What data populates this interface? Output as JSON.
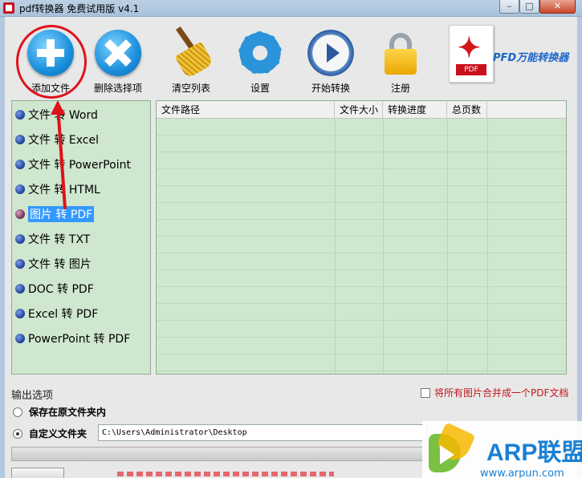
{
  "window": {
    "title": "pdf转换器 免费试用版 v4.1",
    "min_symbol": "–",
    "max_symbol": "□",
    "close_symbol": "✕"
  },
  "toolbar": {
    "buttons": [
      {
        "label": "添加文件",
        "icon": "add-icon"
      },
      {
        "label": "删除选择项",
        "icon": "delete-icon"
      },
      {
        "label": "清空列表",
        "icon": "broom-icon"
      },
      {
        "label": "设置",
        "icon": "gear-icon"
      },
      {
        "label": "开始转换",
        "icon": "play-icon"
      },
      {
        "label": "注册",
        "icon": "lock-icon"
      }
    ],
    "brand": "PFD万能转换器",
    "pdf_tag": "PDF"
  },
  "conversion_types": {
    "selected_index": 4,
    "items": [
      "文件 转 Word",
      "文件 转 Excel",
      "文件 转 PowerPoint",
      "文件 转 HTML",
      "图片 转 PDF",
      "文件 转 TXT",
      "文件 转 图片",
      "DOC 转 PDF",
      "Excel 转 PDF",
      "PowerPoint 转 PDF"
    ]
  },
  "file_table": {
    "columns": [
      "文件路径",
      "文件大小",
      "转换进度",
      "总页数"
    ],
    "rows": []
  },
  "output": {
    "section_title": "输出选项",
    "merge_label": "将所有图片合并成一个PDF文档",
    "merge_checked": false,
    "option_original": "保存在原文件夹内",
    "option_custom": "自定义文件夹",
    "selected_option": "custom",
    "custom_path": "C:\\Users\\Administrator\\Desktop"
  },
  "watermark": {
    "title": "ARP联盟",
    "url": "www.arpun.com"
  },
  "colors": {
    "panel_green": "#cfe7cf",
    "selection": "#3399ff",
    "annotation_red": "#e0121b",
    "brand_blue": "#1a66c9"
  }
}
